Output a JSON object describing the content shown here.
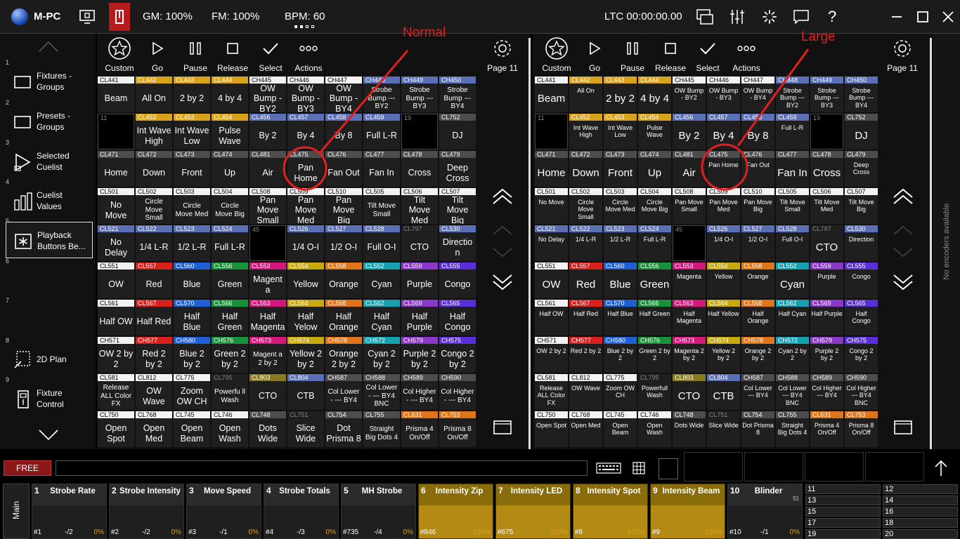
{
  "topbar": {
    "app": "M-PC",
    "gm": "GM: 100%",
    "fm": "FM: 100%",
    "bpm": "BPM: 60",
    "ltc": "LTC 00:00:00.00"
  },
  "annotations": {
    "normal": "Normal",
    "large": "Large"
  },
  "sidebar": [
    {
      "num": "1",
      "label1": "Fixtures -",
      "label2": "Groups",
      "icon": "rectangle-icon"
    },
    {
      "num": "2",
      "label1": "Presets -",
      "label2": "Groups",
      "icon": "rectangle-icon"
    },
    {
      "num": "3",
      "label1": "Selected",
      "label2": "Cuelist",
      "icon": "play-icon"
    },
    {
      "num": "4",
      "label1": "Cuelist",
      "label2": "Values",
      "icon": "bars-icon"
    },
    {
      "num": "5",
      "label1": "Playback",
      "label2": "Buttons Be...",
      "icon": "asterisk-icon"
    },
    {
      "num": "6",
      "label1": "",
      "label2": "",
      "icon": ""
    },
    {
      "num": "7",
      "label1": "",
      "label2": "",
      "icon": ""
    },
    {
      "num": "8",
      "label1": "2D Plan",
      "label2": "",
      "icon": "plan-icon"
    },
    {
      "num": "9",
      "label1": "Fixture",
      "label2": "Control",
      "icon": "fixture-icon"
    }
  ],
  "toolbar": {
    "custom": "Custom",
    "go": "Go",
    "pause": "Pause",
    "release": "Release",
    "select": "Select",
    "actions": "Actions",
    "page": "Page 11"
  },
  "colors": {
    "white": "#f2f2f2",
    "yellow": "#d9a21b",
    "blue": "#5b6fb5",
    "gray": "#4d4d4d",
    "red": "#d8201c",
    "bluebright": "#1e5fd6",
    "green": "#18913a",
    "pink": "#d4177a",
    "gold": "#c8a80f",
    "orange": "#e0741a",
    "cyan": "#17a0b0",
    "purple": "#8a38c8",
    "violet": "#5a2fd8",
    "olive": "#8a7a20",
    "dark": "#000000"
  },
  "grid": [
    [
      [
        "CL441",
        "white",
        "Beam"
      ],
      [
        "CL442",
        "yellow",
        "All On"
      ],
      [
        "CL443",
        "yellow",
        "2 by 2"
      ],
      [
        "CL444",
        "yellow",
        "4 by 4"
      ],
      [
        "CH445",
        "white",
        "OW Bump - BY2"
      ],
      [
        "CH446",
        "white",
        "OW Bump - BY3"
      ],
      [
        "CH447",
        "white",
        "OW Bump - BY4"
      ],
      [
        "CH448",
        "blue",
        "Strobe Bump --- BY2"
      ],
      [
        "CH449",
        "blue",
        "Strobe Bump --- BY3"
      ],
      [
        "CH450",
        "blue",
        "Strobe Bump --- BY4"
      ]
    ],
    [
      [
        "11",
        "dark",
        ""
      ],
      [
        "CL452",
        "yellow",
        "Int Wave High"
      ],
      [
        "CL453",
        "yellow",
        "Int Wave Low"
      ],
      [
        "CL454",
        "yellow",
        "Pulse Wave"
      ],
      [
        "CL456",
        "blue",
        "By 2"
      ],
      [
        "CL457",
        "blue",
        "By 4"
      ],
      [
        "CL458",
        "blue",
        "By 8"
      ],
      [
        "CL459",
        "blue",
        "Full L-R"
      ],
      [
        "19",
        "dark",
        ""
      ],
      [
        "CL752",
        "gray",
        "DJ"
      ]
    ],
    [
      [
        "CL471",
        "gray",
        "Home"
      ],
      [
        "CL472",
        "gray",
        "Down"
      ],
      [
        "CL473",
        "gray",
        "Front"
      ],
      [
        "CL474",
        "gray",
        "Up"
      ],
      [
        "CL481",
        "gray",
        "Air"
      ],
      [
        "CL475",
        "gray",
        "Pan Home"
      ],
      [
        "CL476",
        "gray",
        "Fan Out"
      ],
      [
        "CL477",
        "gray",
        "Fan In"
      ],
      [
        "CL478",
        "gray",
        "Cross"
      ],
      [
        "CL479",
        "gray",
        "Deep Cross"
      ]
    ],
    [
      [
        "CL501",
        "white",
        "No Move"
      ],
      [
        "CL502",
        "white",
        "Circle Move Small"
      ],
      [
        "CL503",
        "white",
        "Circle Move Med"
      ],
      [
        "CL504",
        "white",
        "Circle Move Big"
      ],
      [
        "CL508",
        "white",
        "Pan Move Small"
      ],
      [
        "CL509",
        "white",
        "Pan Move Med"
      ],
      [
        "CL510",
        "white",
        "Pan Move Big"
      ],
      [
        "CL505",
        "white",
        "Tilt Move Small"
      ],
      [
        "CL506",
        "white",
        "Tilt Move Med"
      ],
      [
        "CL507",
        "white",
        "Tilt Move Big"
      ]
    ],
    [
      [
        "CL521",
        "blue",
        "No Delay"
      ],
      [
        "CL522",
        "blue",
        "1/4 L-R"
      ],
      [
        "CL523",
        "blue",
        "1/2 L-R"
      ],
      [
        "CL524",
        "blue",
        "Full L-R"
      ],
      [
        "45",
        "dark",
        ""
      ],
      [
        "CL526",
        "blue",
        "1/4 O-I"
      ],
      [
        "CL527",
        "blue",
        "1/2 O-I"
      ],
      [
        "CL528",
        "blue",
        "Full O-I"
      ],
      [
        "CL797",
        "dark",
        "CTO"
      ],
      [
        "CL530",
        "blue",
        "Direction"
      ]
    ],
    [
      [
        "CL551",
        "white",
        "OW"
      ],
      [
        "CL557",
        "red",
        "Red"
      ],
      [
        "CL560",
        "bluebright",
        "Blue"
      ],
      [
        "CL556",
        "green",
        "Green"
      ],
      [
        "CL553",
        "pink",
        "Magenta"
      ],
      [
        "CL554",
        "gold",
        "Yellow"
      ],
      [
        "CL558",
        "orange",
        "Orange"
      ],
      [
        "CL552",
        "cyan",
        "Cyan"
      ],
      [
        "CL559",
        "purple",
        "Purple"
      ],
      [
        "CL555",
        "violet",
        "Congo"
      ]
    ],
    [
      [
        "CL561",
        "white",
        "Half OW"
      ],
      [
        "CL567",
        "red",
        "Half Red"
      ],
      [
        "CL570",
        "bluebright",
        "Half Blue"
      ],
      [
        "CL566",
        "green",
        "Half Green"
      ],
      [
        "CL563",
        "pink",
        "Half Magenta"
      ],
      [
        "CL564",
        "gold",
        "Half Yellow"
      ],
      [
        "CL568",
        "orange",
        "Half Orange"
      ],
      [
        "CL562",
        "cyan",
        "Half Cyan"
      ],
      [
        "CL569",
        "purple",
        "Half Purple"
      ],
      [
        "CL565",
        "violet",
        "Half Congo"
      ]
    ],
    [
      [
        "CH571",
        "white",
        "OW 2 by 2"
      ],
      [
        "CH577",
        "red",
        "Red 2 by 2"
      ],
      [
        "CH580",
        "bluebright",
        "Blue 2 by 2"
      ],
      [
        "CH576",
        "green",
        "Green 2 by 2"
      ],
      [
        "CH573",
        "pink",
        "Magenta 2 by 2"
      ],
      [
        "CH574",
        "gold",
        "Yellow 2 by 2"
      ],
      [
        "CH578",
        "orange",
        "Orange 2 by 2"
      ],
      [
        "CH572",
        "cyan",
        "Cyan 2 by 2"
      ],
      [
        "CH579",
        "purple",
        "Purple 2 by 2"
      ],
      [
        "CH575",
        "violet",
        "Congo 2 by 2"
      ]
    ],
    [
      [
        "CL581",
        "white",
        "Release ALL Color FX"
      ],
      [
        "CL812",
        "white",
        "OW Wave"
      ],
      [
        "CL775",
        "white",
        "Zoom OW CH"
      ],
      [
        "CL795",
        "dark",
        "Powerfull Wash"
      ],
      [
        "CL803",
        "olive",
        "CTO"
      ],
      [
        "CL804",
        "blue",
        "CTB"
      ],
      [
        "CH587",
        "gray",
        "Col Lower --- BY4"
      ],
      [
        "CH588",
        "gray",
        "Col Lower --- BY4 BNC"
      ],
      [
        "CH589",
        "gray",
        "Col Higher --- BY4"
      ],
      [
        "CH590",
        "gray",
        "Col Higher --- BY4 BNC"
      ]
    ],
    [
      [
        "CL750",
        "white",
        "Open Spot"
      ],
      [
        "CL768",
        "white",
        "Open Med"
      ],
      [
        "CL745",
        "white",
        "Open Beam"
      ],
      [
        "CL746",
        "white",
        "Open Wash"
      ],
      [
        "CL748",
        "gray",
        "Dots Wide"
      ],
      [
        "CL751",
        "dark",
        "Slice Wide"
      ],
      [
        "CL754",
        "gray",
        "Dot Prisma 8"
      ],
      [
        "CL755",
        "gray",
        "Straight Big Dots 4"
      ],
      [
        "CL631",
        "orange",
        "Prisma 4 On/Off"
      ],
      [
        "CL753",
        "orange",
        "Prisma 8 On/Off"
      ]
    ]
  ],
  "normal_labels": [
    [
      "Beam",
      "All On",
      "2 by 2",
      "4 by 4",
      "OW Bump - BY2",
      "OW Bump - BY3",
      "OW Bump - BY4",
      "Strobe Bump --- BY2",
      "Strobe Bump --- BY3",
      "Strobe Bump --- BY4"
    ],
    [
      "",
      "Int Wave High",
      "Int Wave Low",
      "Pulse Wave",
      "By 2",
      "By 4",
      "By 8",
      "Full L-R",
      "",
      "DJ"
    ],
    [
      "Home",
      "Down",
      "Front",
      "Up",
      "Air",
      "Pan Home",
      "Fan Out",
      "Fan In",
      "Cross",
      "Deep Cross"
    ],
    [
      "No Move",
      "Circle Move Small",
      "Circle Move Med",
      "Circle Move Big",
      "Pan Move Small",
      "Pan Move Med",
      "Pan Move Big",
      "Tilt Move Small",
      "Tilt Move Med",
      "Tilt Move Big"
    ],
    [
      "No Delay",
      "1/4 L-R",
      "1/2 L-R",
      "Full L-R",
      "",
      "1/4 O-I",
      "1/2 O-I",
      "Full O-I",
      "CTO",
      "Directio n"
    ],
    [
      "OW",
      "Red",
      "Blue",
      "Green",
      "Magent a",
      "Yellow",
      "Orange",
      "Cyan",
      "Purple",
      "Congo"
    ],
    [
      "Half OW",
      "Half Red",
      "Half Blue",
      "Half Green",
      "Half Magenta",
      "Half Yelow",
      "Half Orange",
      "Half Cyan",
      "Half Purple",
      "Half Congo"
    ],
    [
      "OW 2 by 2",
      "Red 2 by 2",
      "Blue 2 by 2",
      "Green 2 by 2",
      "Magent a 2 by 2",
      "Yellow 2 by 2",
      "Orange 2 by 2",
      "Cyan 2 by 2",
      "Purple 2 by 2",
      "Congo 2 by 2"
    ],
    [
      "Release ALL Color FX",
      "OW Wave",
      "Zoom OW CH",
      "Powerfu ll Wash",
      "CTO",
      "CTB",
      "Col Lower - --- BY4",
      "Col Lower - --- BY4 BNC",
      "Col Higher - --- BY4",
      "Col Higher - --- BY4"
    ],
    [
      "Open Spot",
      "Open Med",
      "Open Beam",
      "Open Wash",
      "Dots Wide",
      "Slice Wide",
      "Dot Prisma 8",
      "Straight Big Dots 4",
      "Prisma 4 On/Off",
      "Prisma 8 On/Off"
    ]
  ],
  "large_big": [
    "Beam",
    "2 by 2",
    "4 by 4",
    "By 2",
    "By 4",
    "By 8",
    "DJ",
    "Home",
    "Down",
    "Front",
    "Up",
    "Air",
    "Fan In",
    "Cross",
    "CTO",
    "OW",
    "Red",
    "Blue",
    "Green",
    "Cyan",
    "CTB"
  ],
  "cmdline": {
    "free": "FREE"
  },
  "side_text": "No encoders available",
  "executors": [
    {
      "num": "1",
      "name": "Strobe Rate",
      "id": "#1",
      "v": "-/2",
      "pct": "0%",
      "hi": false
    },
    {
      "num": "2",
      "name": "Strobe Intensity",
      "id": "#2",
      "v": "-/2",
      "pct": "0%",
      "hi": false
    },
    {
      "num": "3",
      "name": "Move Speed",
      "id": "#3",
      "v": "-/1",
      "pct": "0%",
      "hi": false
    },
    {
      "num": "4",
      "name": "Strobe Totals",
      "id": "#4",
      "v": "-/3",
      "pct": "0%",
      "hi": false
    },
    {
      "num": "5",
      "name": "MH Strobe",
      "id": "#735",
      "v": "-/4",
      "pct": "0%",
      "hi": false
    },
    {
      "num": "6",
      "name": "Intensity Zip",
      "id": "#846",
      "v": "",
      "pct": "100%",
      "hi": true
    },
    {
      "num": "7",
      "name": "Intensity LED",
      "id": "#675",
      "v": "",
      "pct": "100%",
      "hi": true
    },
    {
      "num": "8",
      "name": "Intensity Spot",
      "id": "#8",
      "v": "",
      "pct": "100%",
      "hi": true
    },
    {
      "num": "9",
      "name": "Intensity Beam",
      "id": "#9",
      "v": "",
      "pct": "100%",
      "hi": true
    },
    {
      "num": "10",
      "name": "Blinder",
      "id": "#10",
      "v": "-/1",
      "pct": "0%",
      "hi": false
    }
  ],
  "exec_badge": "51",
  "main_label": "Main",
  "mini_execs": [
    "11",
    "12",
    "13",
    "14",
    "15",
    "16",
    "17",
    "18",
    "19",
    "20"
  ]
}
